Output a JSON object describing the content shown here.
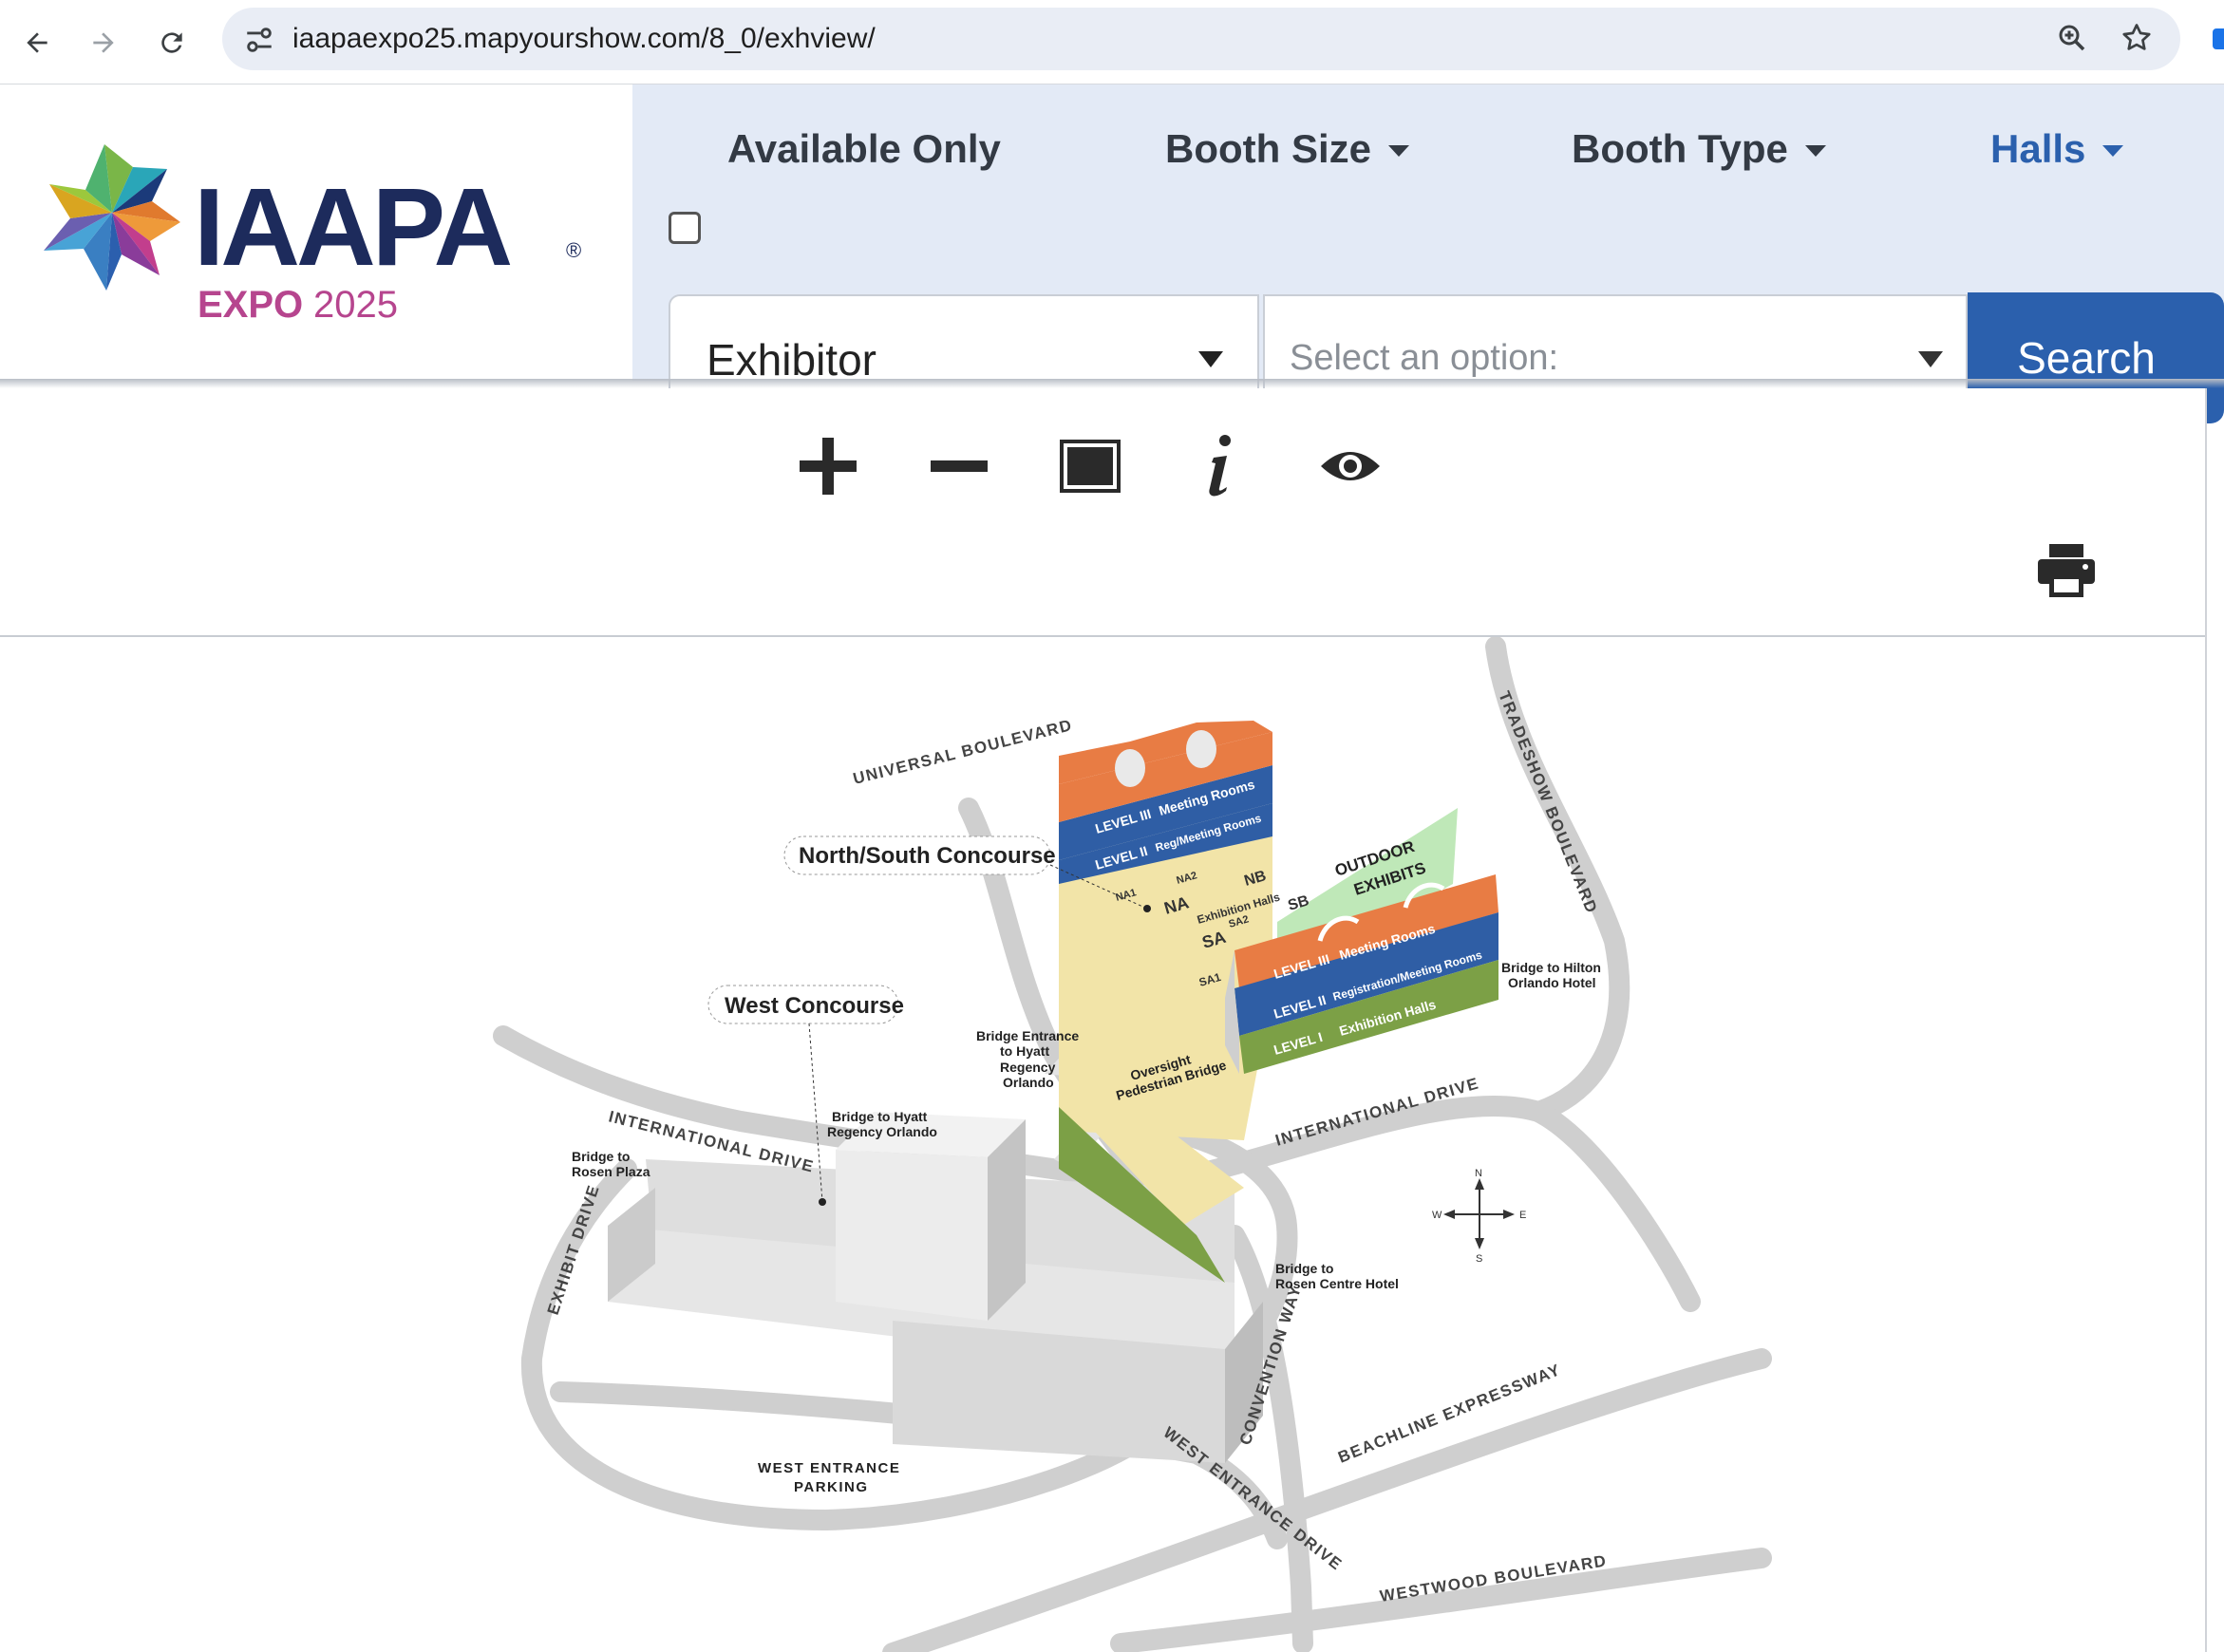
{
  "browser": {
    "url": "iaapaexpo25.mapyourshow.com/8_0/exhview/",
    "icons": [
      "back-arrow-icon",
      "forward-arrow-icon",
      "reload-icon",
      "site-info-icon",
      "zoom-icon",
      "bookmark-star-icon"
    ]
  },
  "logo": {
    "wordmark": "IAAPA",
    "registered": "®",
    "expo": "EXPO",
    "year": "2025"
  },
  "filters": {
    "available_only": "Available Only",
    "booth_size": "Booth Size",
    "booth_type": "Booth Type",
    "halls": "Halls",
    "search_field_value": "Exhibitor",
    "option_placeholder": "Select an option:",
    "search_button": "Search"
  },
  "toolbar": {
    "icons": [
      "zoom-in-icon",
      "zoom-out-icon",
      "fit-screen-icon",
      "info-icon",
      "visibility-icon",
      "print-icon"
    ]
  },
  "map": {
    "streets": {
      "universal": "UNIVERSAL BOULEVARD",
      "tradeshow": "TRADESHOW BOULEVARD",
      "intl_west": "INTERNATIONAL DRIVE",
      "intl_east": "INTERNATIONAL DRIVE",
      "exhibit": "EXHIBIT DRIVE",
      "convention": "CONVENTION WAY",
      "beachline": "BEACHLINE EXPRESSWAY",
      "west_entrance": "WEST ENTRANCE DRIVE",
      "westwood": "WESTWOOD BOULEVARD"
    },
    "labels": {
      "ns_concourse": "North/South Concourse",
      "west_concourse": "West Concourse",
      "outdoor_exhibits_1": "OUTDOOR",
      "outdoor_exhibits_2": "EXHIBITS",
      "bridge_hyatt_entrance_1": "Bridge Entrance",
      "bridge_hyatt_entrance_2": "to Hyatt",
      "bridge_hyatt_entrance_3": "Regency",
      "bridge_hyatt_entrance_4": "Orlando",
      "oversight_1": "Oversight",
      "oversight_2": "Pedestrian Bridge",
      "bridge_hyatt_1": "Bridge to Hyatt",
      "bridge_hyatt_2": "Regency Orlando",
      "bridge_rosen_plaza_1": "Bridge to",
      "bridge_rosen_plaza_2": "Rosen Plaza",
      "bridge_hilton_1": "Bridge to Hilton",
      "bridge_hilton_2": "Orlando Hotel",
      "bridge_rosen_centre_1": "Bridge to",
      "bridge_rosen_centre_2": "Rosen Centre Hotel",
      "west_parking_1": "WEST ENTRANCE",
      "west_parking_2": "PARKING"
    },
    "north_bldg": {
      "level3": "LEVEL III",
      "level3_desc": "Meeting Rooms",
      "level2": "LEVEL II",
      "level2_desc": "Reg/Meeting Rooms",
      "na1": "NA1",
      "na2": "NA2",
      "na": "NA",
      "nb": "NB",
      "exhibition_halls": "Exhibition Halls",
      "sa": "SA",
      "sa1": "SA1",
      "sa2": "SA2",
      "sb": "SB"
    },
    "south_bldg": {
      "level3": "LEVEL III",
      "level3_desc": "Meeting Rooms",
      "level2": "LEVEL II",
      "level2_desc": "Registration/Meeting Rooms",
      "level1": "LEVEL I",
      "level1_desc": "Exhibition Halls"
    },
    "compass": {
      "n": "N",
      "s": "S",
      "e": "E",
      "w": "W"
    }
  }
}
